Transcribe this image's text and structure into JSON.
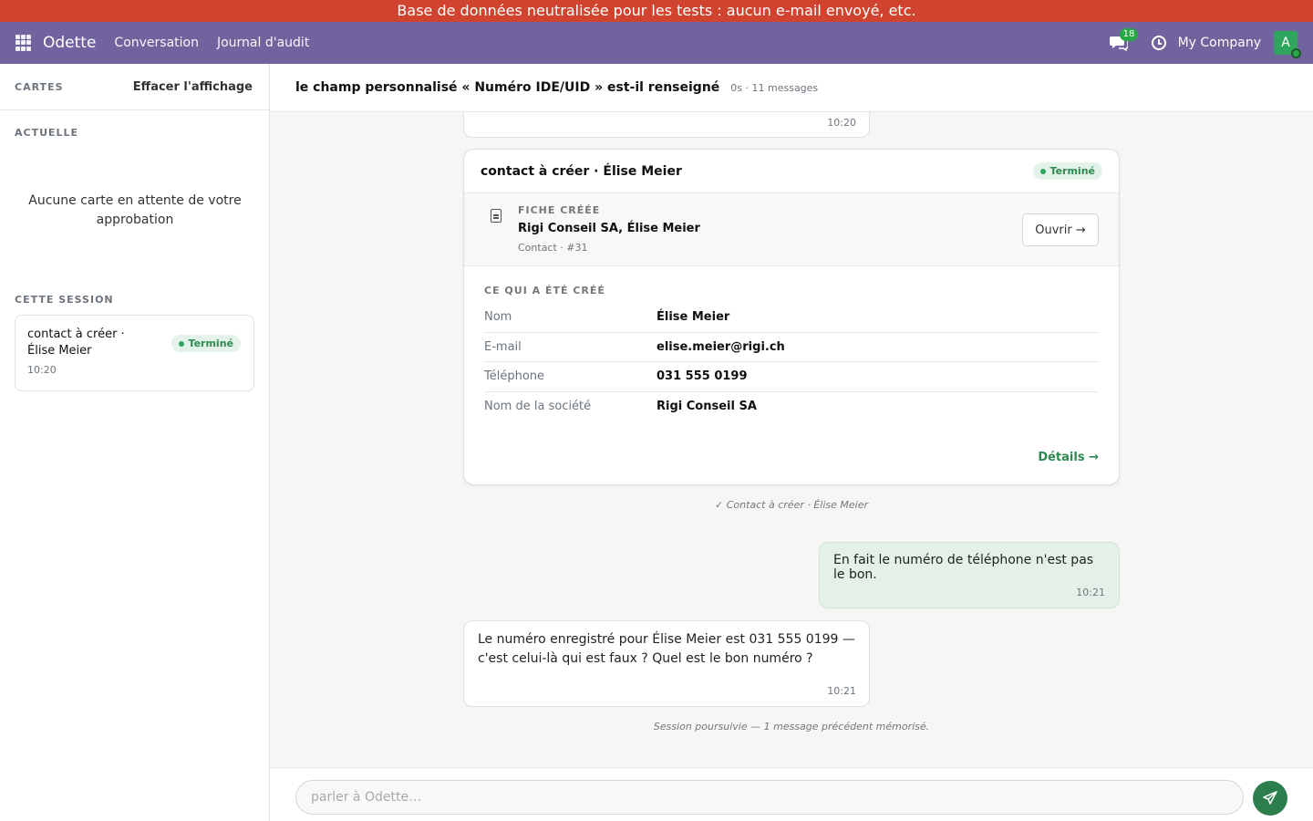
{
  "banner": {
    "text": "Base de données neutralisée pour les tests : aucun e-mail envoyé, etc."
  },
  "navbar": {
    "brand": "Odette",
    "links": [
      "Conversation",
      "Journal d'audit"
    ],
    "chat_count": "18",
    "company": "My Company",
    "avatar_initial": "A"
  },
  "sidebar": {
    "header_label": "CARTES",
    "clear_label": "Effacer l'affichage",
    "current_label": "ACTUELLE",
    "empty_message": "Aucune carte en attente de votre approbation",
    "session_label": "CETTE SESSION",
    "session_card": {
      "title": "contact à créer · Élise Meier",
      "status": "Terminé",
      "time": "10:20"
    }
  },
  "main": {
    "title": "le champ personnalisé « Numéro IDE/UID » est-il renseigné",
    "meta": "0s · 11 messages",
    "partial_time": "10:20",
    "card": {
      "title": "contact à créer · Élise Meier",
      "status": "Terminé",
      "record_label": "FICHE CRÉÉE",
      "record_name": "Rigi Conseil SA, Élise Meier",
      "record_sub": "Contact · #31",
      "open_label": "Ouvrir →",
      "created_label": "CE QUI A ÉTÉ CRÉÉ",
      "fields": [
        {
          "label": "Nom",
          "value": "Élise Meier"
        },
        {
          "label": "E-mail",
          "value": "elise.meier@rigi.ch"
        },
        {
          "label": "Téléphone",
          "value": "031 555 0199"
        },
        {
          "label": "Nom de la société",
          "value": "Rigi Conseil SA"
        }
      ],
      "details_label": "Détails →"
    },
    "note1": "✓ Contact à créer · Élise Meier",
    "user_msg": {
      "text": "En fait le numéro de téléphone n'est pas le bon.",
      "time": "10:21"
    },
    "bot_msg": {
      "text": "Le numéro enregistré pour Élise Meier est 031 555 0199 — c'est celui-là qui est faux ? Quel est le bon numéro ?",
      "time": "10:21"
    },
    "note2": "Session poursuivie — 1 message précédent mémorisé.",
    "composer": {
      "placeholder": "parler à Odette…"
    }
  },
  "colors": {
    "banner": "#d0432e",
    "navbar": "#71639e",
    "accent": "#2d7e4d",
    "user_bubble": "#e3f1e8"
  }
}
